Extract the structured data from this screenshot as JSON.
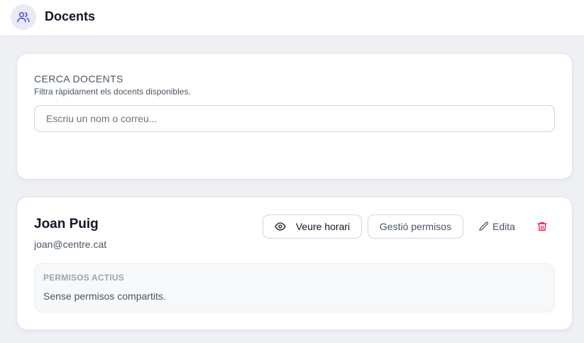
{
  "header": {
    "title": "Docents",
    "icon": "users-icon"
  },
  "search": {
    "heading": "CERCA DOCENTS",
    "subtitle": "Filtra ràpidament els docents disponibles.",
    "value": "",
    "placeholder": "Escriu un nom o correu..."
  },
  "teachers": [
    {
      "name": "Joan Puig",
      "email": "joan@centre.cat",
      "actions": {
        "view_schedule": "Veure horari",
        "manage_permissions": "Gestió permisos",
        "edit": "Edita",
        "delete_icon": "trash-icon"
      },
      "permissions": {
        "label": "PERMISOS ACTIUS",
        "value": "Sense permisos compartits."
      }
    }
  ],
  "colors": {
    "accent": "#4f46e5",
    "danger": "#e11d48",
    "background": "#eef0f4"
  }
}
